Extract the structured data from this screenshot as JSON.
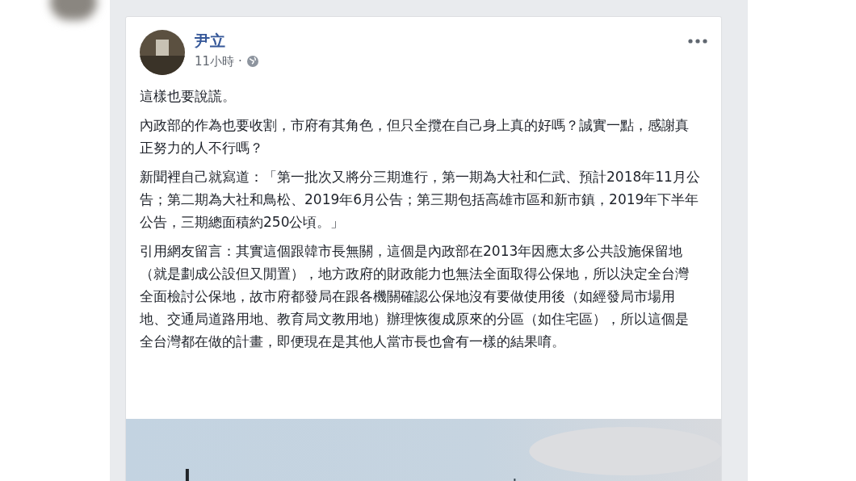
{
  "post": {
    "author": "尹立",
    "time": "11小時",
    "separator": "·",
    "paragraphs": [
      "這樣也要說謊。",
      "內政部的作為也要收割，市府有其角色，但只全攬在自己身上真的好嗎？誠實一點，感謝真正努力的人不行嗎？",
      "新聞裡自己就寫道：「第一批次又將分三期進行，第一期為大社和仁武、預計2018年11月公告；第二期為大社和鳥松、2019年6月公告；第三期包括高雄市區和新市鎮，2019年下半年公告，三期總面積約250公頃。」",
      "引用網友留言：其實這個跟韓市長無關，這個是內政部在2013年因應太多公共設施保留地（就是劃成公設但又閒置），地方政府的財政能力也無法全面取得公保地，所以決定全台灣全面檢討公保地，故市府都發局在跟各機關確認公保地沒有要做使用後（如經發局市場用地、交通局道路用地、教育局文教用地）辦理恢復成原來的分區（如住宅區），所以這個是全台灣都在做的計畫，即便現在是其他人當市長也會有一樣的結果唷。"
    ]
  }
}
